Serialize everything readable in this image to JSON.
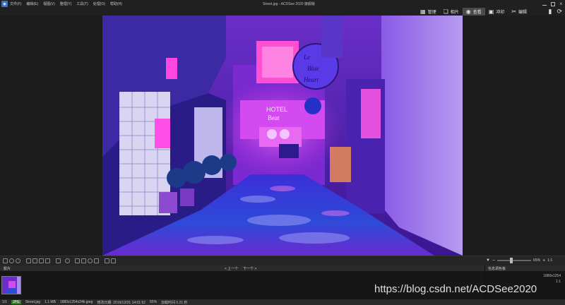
{
  "menubar": {
    "items": [
      "文件(F)",
      "编辑(E)",
      "视图(V)",
      "整理(Y)",
      "工具(T)",
      "处理(O)",
      "帮助(H)"
    ]
  },
  "window": {
    "title": "Street.jpg - ACDSee 2020 旗舰版"
  },
  "mode_tabs": [
    {
      "label": "管理",
      "icon": "grid-icon"
    },
    {
      "label": "相片",
      "icon": "photos-icon"
    },
    {
      "label": "查看",
      "icon": "eye-icon"
    },
    {
      "label": "冲印",
      "icon": "develop-icon"
    },
    {
      "label": "编辑",
      "icon": "edit-icon"
    }
  ],
  "active_mode": "查看",
  "filmstrip": {
    "title": "胶片",
    "prev_label": "< 上一个",
    "next_label": "下一个 >"
  },
  "zoom": {
    "level": "65%",
    "slider_fraction": 0.35
  },
  "info_panel": {
    "title": "信息调色板",
    "values": [
      "1880x1254",
      "1:1"
    ]
  },
  "status": {
    "index": "1/1",
    "format": "JPG",
    "filename": "Street.jpg",
    "filesize": "1.1 MB",
    "dimensions": "1880x1254x24b jpeg",
    "modified": "修改日期: 2019/12/31 14:01:52",
    "zoom": "65%",
    "load_time": "加载时间 0.21 秒"
  },
  "watermark": "https://blog.csdn.net/ACDSee2020",
  "colors": {
    "accent": "#3c73b8",
    "photo_magenta": "#c238e0",
    "photo_blue": "#2a3fd0"
  }
}
